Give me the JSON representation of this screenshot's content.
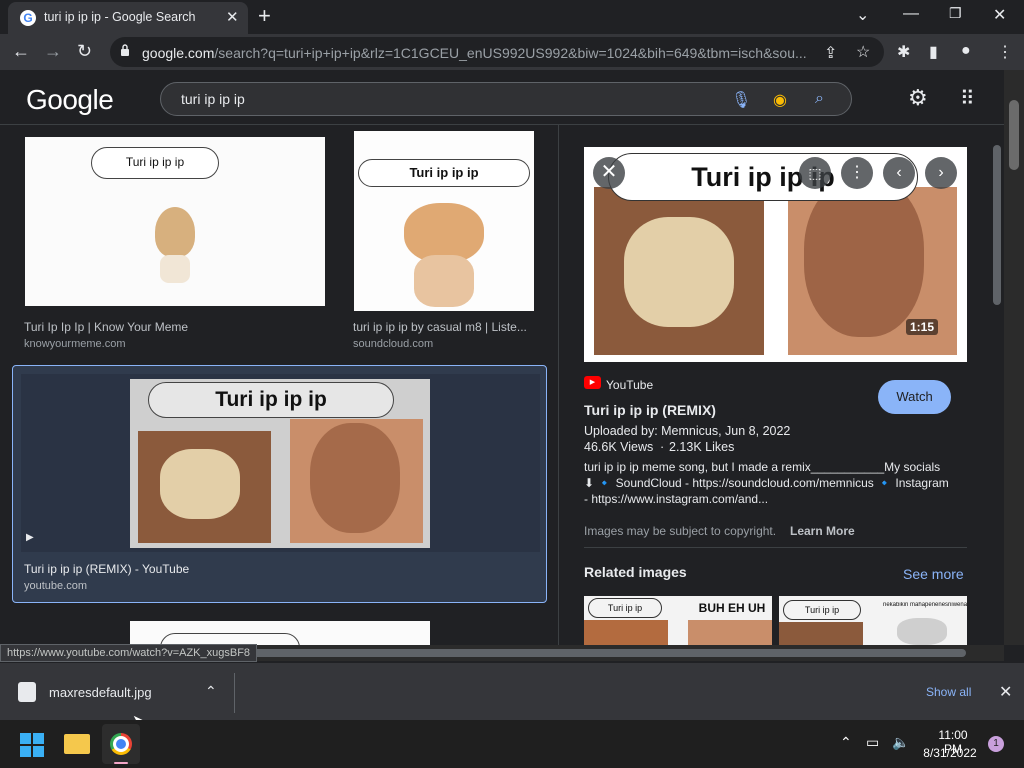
{
  "tab": {
    "title": "turi ip ip ip - Google Search",
    "favicon": "G"
  },
  "address_bar": {
    "host": "google.com",
    "path": "/search?q=turi+ip+ip+ip&rlz=1C1GCEU_enUS992US992&biw=1024&bih=649&tbm=isch&sou..."
  },
  "google": {
    "logo": "Google",
    "query": "turi ip ip ip"
  },
  "results": [
    {
      "title": "Turi Ip Ip Ip | Know Your Meme",
      "source": "knowyourmeme.com",
      "bubble": "Turi ip ip ip"
    },
    {
      "title": "turi ip ip ip by casual m8 | Liste...",
      "source": "soundcloud.com",
      "bubble": "Turi ip ip ip"
    },
    {
      "title": "Turi ip ip ip (REMIX) - YouTube",
      "source": "youtube.com",
      "bubble": "Turi ip ip ip"
    }
  ],
  "panel": {
    "image_caption": "Turi ip ip ip",
    "duration": "1:15",
    "channel": "YouTube",
    "title": "Turi ip ip ip (REMIX)",
    "uploaded": "Uploaded by: Memnicus, Jun 8, 2022",
    "views": "46.6K Views",
    "dot": "·",
    "likes": "2.13K Likes",
    "desc1": "turi ip ip ip meme song, but I made a remix___________My socials",
    "desc2": "⬇ 🔹 SoundCloud - https://soundcloud.com/memnicus 🔹 Instagram",
    "desc3": "- https://www.instagram.com/and...",
    "watch": "Watch",
    "copyright": "Images may be subject to copyright.",
    "learn_more": "Learn More",
    "related": "Related images",
    "see_more": "See more",
    "related_texts": [
      "Turi ip ip",
      "BUH EH UH",
      "Turi ip ip",
      "nekabikin mahapenenesniwenahin"
    ]
  },
  "status_url": "https://www.youtube.com/watch?v=AZK_xugsBF8",
  "download": {
    "file": "maxresdefault.jpg",
    "show_all": "Show all"
  },
  "taskbar": {
    "time": "11:00 PM",
    "date": "8/31/2022",
    "notif": "1"
  },
  "colors": {
    "accent": "#8ab4f8",
    "watch_bg": "#8ab4f8",
    "selected_card": "#303b4d"
  }
}
